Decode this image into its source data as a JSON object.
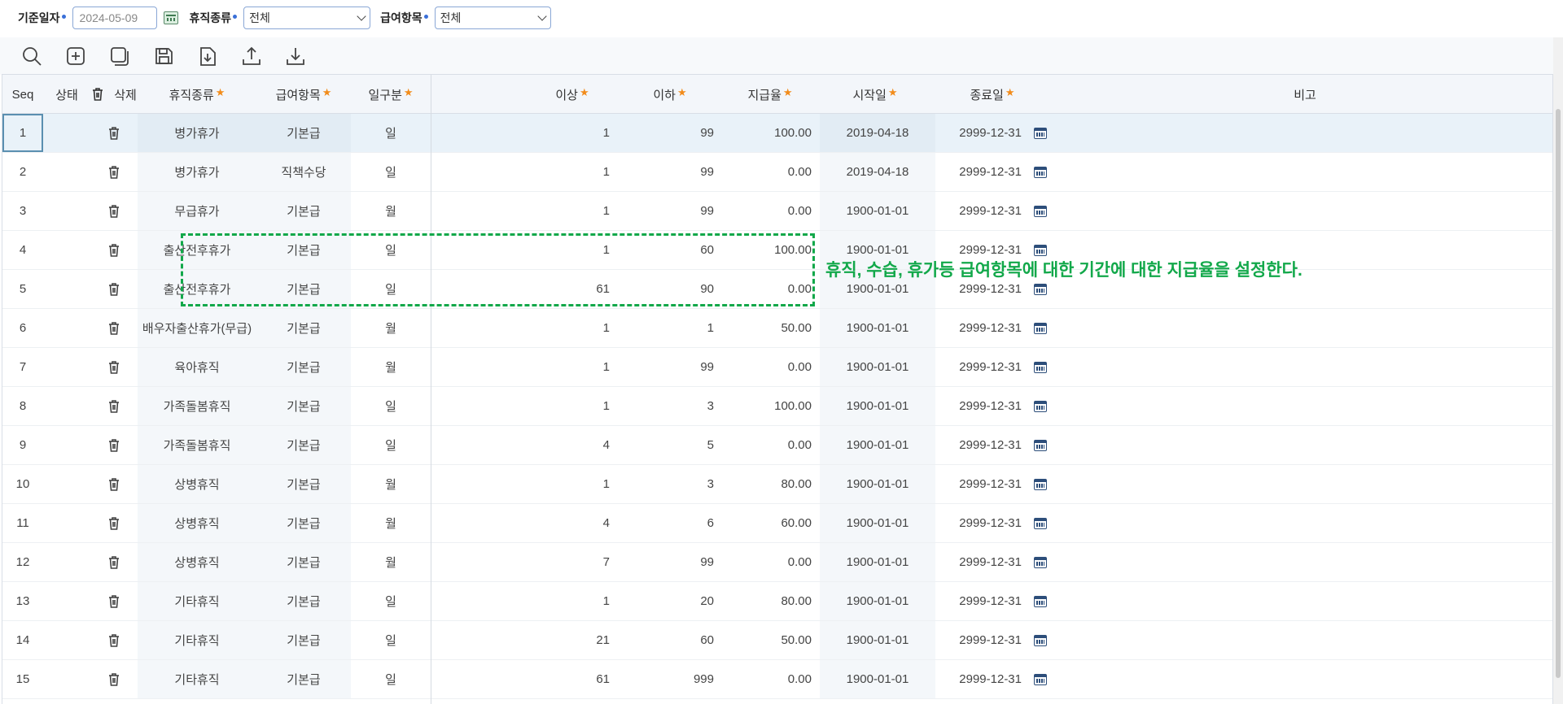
{
  "filters": {
    "base_date_label": "기준일자",
    "base_date_value": "2024-05-09",
    "leave_type_label": "휴직종류",
    "leave_type_value": "전체",
    "pay_item_label": "급여항목",
    "pay_item_value": "전체"
  },
  "toolbar": {
    "icons": [
      "search-icon",
      "add-icon",
      "copy-icon",
      "save-icon",
      "download-file-icon",
      "upload-icon",
      "download-icon"
    ]
  },
  "columns": {
    "seq": "Seq",
    "status": "상태",
    "delete": "삭제",
    "leave_type": "휴직종류",
    "pay_item": "급여항목",
    "day_unit": "일구분",
    "from": "이상",
    "to": "이하",
    "rate": "지급율",
    "start": "시작일",
    "end": "종료일",
    "note": "비고"
  },
  "rows": [
    {
      "seq": "1",
      "leave_type": "병가휴가",
      "pay_item": "기본급",
      "day_unit": "일",
      "from": "1",
      "to": "99",
      "rate": "100.00",
      "start": "2019-04-18",
      "end": "2999-12-31"
    },
    {
      "seq": "2",
      "leave_type": "병가휴가",
      "pay_item": "직책수당",
      "day_unit": "일",
      "from": "1",
      "to": "99",
      "rate": "0.00",
      "start": "2019-04-18",
      "end": "2999-12-31"
    },
    {
      "seq": "3",
      "leave_type": "무급휴가",
      "pay_item": "기본급",
      "day_unit": "월",
      "from": "1",
      "to": "99",
      "rate": "0.00",
      "start": "1900-01-01",
      "end": "2999-12-31"
    },
    {
      "seq": "4",
      "leave_type": "출산전후휴가",
      "pay_item": "기본급",
      "day_unit": "일",
      "from": "1",
      "to": "60",
      "rate": "100.00",
      "start": "1900-01-01",
      "end": "2999-12-31"
    },
    {
      "seq": "5",
      "leave_type": "출산전후휴가",
      "pay_item": "기본급",
      "day_unit": "일",
      "from": "61",
      "to": "90",
      "rate": "0.00",
      "start": "1900-01-01",
      "end": "2999-12-31"
    },
    {
      "seq": "6",
      "leave_type": "배우자출산휴가(무급)",
      "pay_item": "기본급",
      "day_unit": "월",
      "from": "1",
      "to": "1",
      "rate": "50.00",
      "start": "1900-01-01",
      "end": "2999-12-31"
    },
    {
      "seq": "7",
      "leave_type": "육아휴직",
      "pay_item": "기본급",
      "day_unit": "월",
      "from": "1",
      "to": "99",
      "rate": "0.00",
      "start": "1900-01-01",
      "end": "2999-12-31"
    },
    {
      "seq": "8",
      "leave_type": "가족돌봄휴직",
      "pay_item": "기본급",
      "day_unit": "일",
      "from": "1",
      "to": "3",
      "rate": "100.00",
      "start": "1900-01-01",
      "end": "2999-12-31"
    },
    {
      "seq": "9",
      "leave_type": "가족돌봄휴직",
      "pay_item": "기본급",
      "day_unit": "일",
      "from": "4",
      "to": "5",
      "rate": "0.00",
      "start": "1900-01-01",
      "end": "2999-12-31"
    },
    {
      "seq": "10",
      "leave_type": "상병휴직",
      "pay_item": "기본급",
      "day_unit": "월",
      "from": "1",
      "to": "3",
      "rate": "80.00",
      "start": "1900-01-01",
      "end": "2999-12-31"
    },
    {
      "seq": "11",
      "leave_type": "상병휴직",
      "pay_item": "기본급",
      "day_unit": "월",
      "from": "4",
      "to": "6",
      "rate": "60.00",
      "start": "1900-01-01",
      "end": "2999-12-31"
    },
    {
      "seq": "12",
      "leave_type": "상병휴직",
      "pay_item": "기본급",
      "day_unit": "월",
      "from": "7",
      "to": "99",
      "rate": "0.00",
      "start": "1900-01-01",
      "end": "2999-12-31"
    },
    {
      "seq": "13",
      "leave_type": "기타휴직",
      "pay_item": "기본급",
      "day_unit": "일",
      "from": "1",
      "to": "20",
      "rate": "80.00",
      "start": "1900-01-01",
      "end": "2999-12-31"
    },
    {
      "seq": "14",
      "leave_type": "기타휴직",
      "pay_item": "기본급",
      "day_unit": "일",
      "from": "21",
      "to": "60",
      "rate": "50.00",
      "start": "1900-01-01",
      "end": "2999-12-31"
    },
    {
      "seq": "15",
      "leave_type": "기타휴직",
      "pay_item": "기본급",
      "day_unit": "일",
      "from": "61",
      "to": "999",
      "rate": "0.00",
      "start": "1900-01-01",
      "end": "2999-12-31"
    }
  ],
  "annotation": {
    "text": "휴직, 수습, 휴가등 급여항목에 대한 기간에 대한 지급율을 설정한다.",
    "color": "#12a84a"
  },
  "colors": {
    "required_star": "#f28c1b",
    "selected_row": "#e9f2f9",
    "header_bg": "#f3f6fa"
  }
}
